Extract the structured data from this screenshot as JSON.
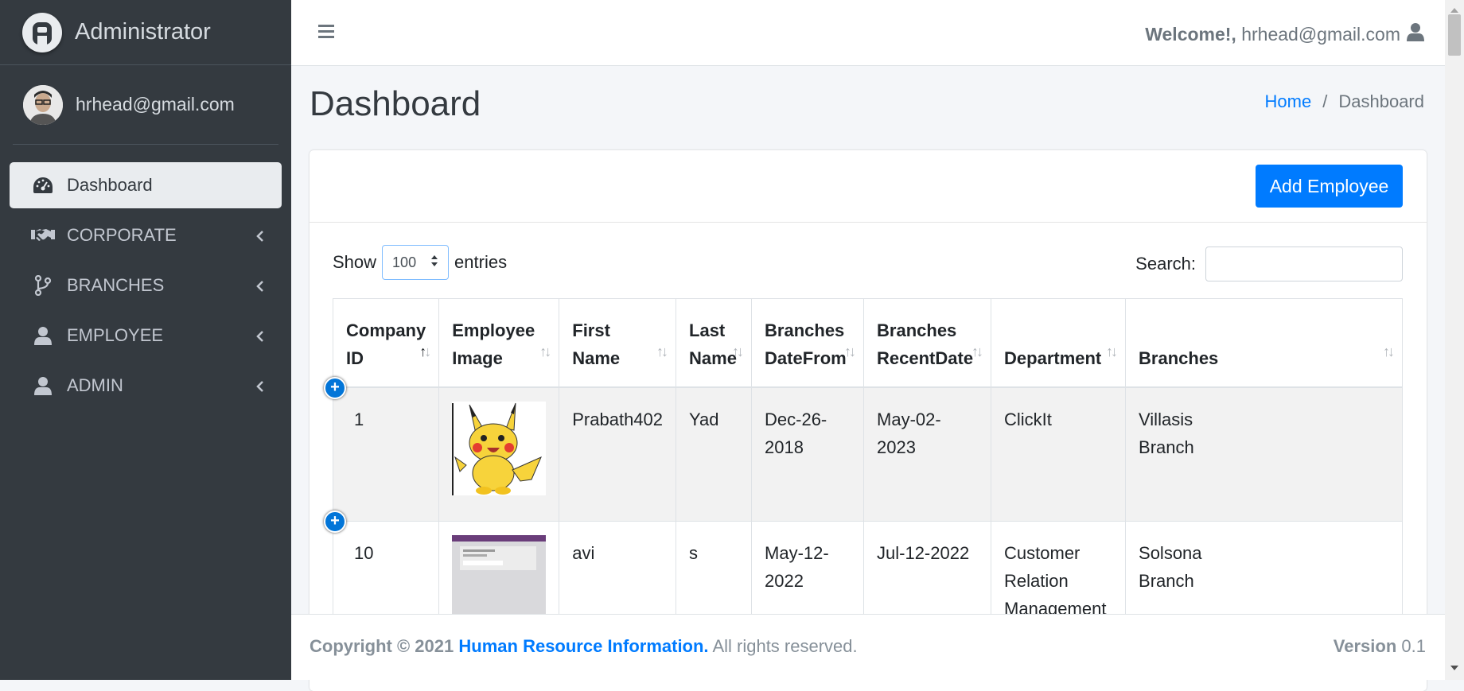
{
  "brand": {
    "name": "Administrator"
  },
  "user": {
    "email": "hrhead@gmail.com"
  },
  "nav": [
    {
      "label": "Dashboard",
      "icon": "tachometer-icon",
      "active": true
    },
    {
      "label": "CORPORATE",
      "icon": "handshake-icon"
    },
    {
      "label": "BRANCHES",
      "icon": "code-branch-icon"
    },
    {
      "label": "EMPLOYEE",
      "icon": "user-icon"
    },
    {
      "label": "ADMIN",
      "icon": "user-icon"
    }
  ],
  "topbar": {
    "welcome": "Welcome!,",
    "email": "hrhead@gmail.com"
  },
  "header": {
    "title": "Dashboard",
    "breadcrumb": [
      "Home",
      "Dashboard"
    ]
  },
  "card": {
    "add_button": "Add Employee"
  },
  "table_controls": {
    "show_label": "Show",
    "entries_value": "100",
    "entries_label": "entries",
    "search_label": "Search:"
  },
  "table": {
    "columns": [
      [
        "Company",
        "ID"
      ],
      [
        "Employee",
        "Image"
      ],
      [
        "First",
        "Name"
      ],
      [
        "Last",
        "Name"
      ],
      [
        "Branches",
        "DateFrom"
      ],
      [
        "Branches",
        "RecentDate"
      ],
      [
        "",
        "Department"
      ],
      [
        "",
        "Branches"
      ]
    ],
    "rows": [
      {
        "company_id": "1",
        "first_name": "Prabath402",
        "last_name": "Yad",
        "date_from": "Dec-26-2018",
        "recent_date": "May-02-2023",
        "department": "ClickIt",
        "branches": [
          "Villasis",
          "Branch"
        ]
      },
      {
        "company_id": "10",
        "first_name": "avi",
        "last_name": "s",
        "date_from": "May-12-2022",
        "recent_date": "Jul-12-2022",
        "department": [
          "Customer",
          "Relation",
          "Management"
        ],
        "branches": [
          "Solsona",
          "Branch"
        ]
      }
    ]
  },
  "footer": {
    "copyright": "Copyright © 2021",
    "org": "Human Resource Information.",
    "rights": " All rights reserved.",
    "version_label": "Version",
    "version_value": "0.1"
  },
  "colors": {
    "primary": "#007bff",
    "sidebar": "#343a40",
    "badge": "#0275d8"
  }
}
